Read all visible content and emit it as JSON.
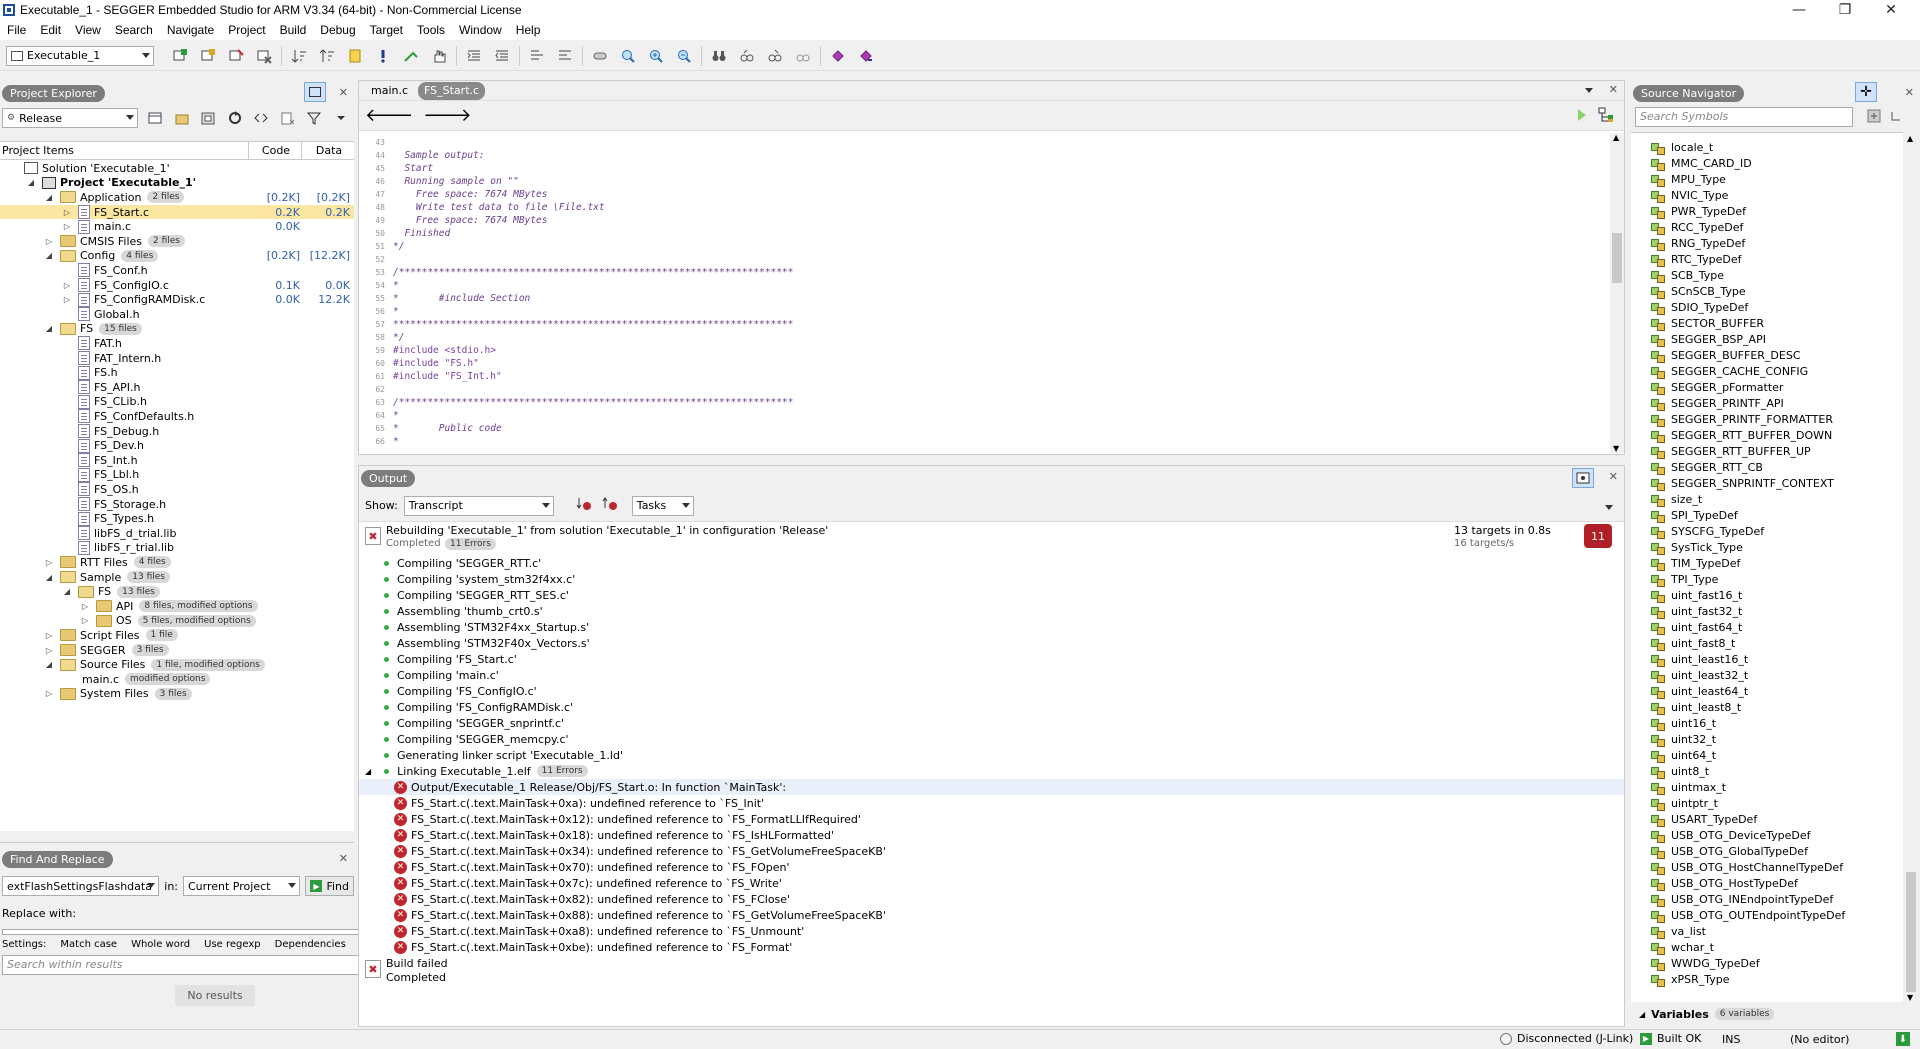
{
  "window": {
    "title": "Executable_1 - SEGGER Embedded Studio for ARM V3.34 (64-bit) - Non-Commercial License",
    "minimize": "—",
    "maximize": "❐",
    "close": "✕"
  },
  "menu": [
    "File",
    "Edit",
    "View",
    "Search",
    "Navigate",
    "Project",
    "Build",
    "Debug",
    "Target",
    "Tools",
    "Window",
    "Help"
  ],
  "toolbar": {
    "project_combo": "Executable_1"
  },
  "project_explorer": {
    "title": "Project Explorer",
    "config": "Release",
    "columns": {
      "items": "Project Items",
      "code": "Code",
      "data": "Data"
    },
    "rows": [
      {
        "label": "Solution 'Executable_1'",
        "kind": "solution",
        "indent": 0,
        "tw": "",
        "badge": "",
        "code": "",
        "data": ""
      },
      {
        "label": "Project 'Executable_1'",
        "kind": "project",
        "indent": 1,
        "tw": "◢",
        "badge": "",
        "code": "",
        "data": "",
        "bold": true
      },
      {
        "label": "Application",
        "kind": "folder-open",
        "indent": 2,
        "tw": "◢",
        "badge": "2 files",
        "code": "[0.2K]",
        "data": "[0.2K]"
      },
      {
        "label": "FS_Start.c",
        "kind": "file",
        "indent": 3,
        "tw": "▷",
        "badge": "",
        "code": "0.2K",
        "data": "0.2K",
        "sel": true
      },
      {
        "label": "main.c",
        "kind": "file",
        "indent": 3,
        "tw": "▷",
        "badge": "",
        "code": "0.0K",
        "data": ""
      },
      {
        "label": "CMSIS Files",
        "kind": "folder",
        "indent": 2,
        "tw": "▷",
        "badge": "2 files",
        "code": "",
        "data": ""
      },
      {
        "label": "Config",
        "kind": "folder-open",
        "indent": 2,
        "tw": "◢",
        "badge": "4 files",
        "code": "[0.2K]",
        "data": "[12.2K]"
      },
      {
        "label": "FS_Conf.h",
        "kind": "file",
        "indent": 3,
        "tw": "",
        "badge": "",
        "code": "",
        "data": ""
      },
      {
        "label": "FS_ConfigIO.c",
        "kind": "file",
        "indent": 3,
        "tw": "▷",
        "badge": "",
        "code": "0.1K",
        "data": "0.0K"
      },
      {
        "label": "FS_ConfigRAMDisk.c",
        "kind": "file",
        "indent": 3,
        "tw": "▷",
        "badge": "",
        "code": "0.0K",
        "data": "12.2K"
      },
      {
        "label": "Global.h",
        "kind": "file",
        "indent": 3,
        "tw": "",
        "badge": "",
        "code": "",
        "data": ""
      },
      {
        "label": "FS",
        "kind": "folder-open",
        "indent": 2,
        "tw": "◢",
        "badge": "15 files",
        "code": "",
        "data": ""
      },
      {
        "label": "FAT.h",
        "kind": "file",
        "indent": 3,
        "tw": "",
        "badge": "",
        "code": "",
        "data": ""
      },
      {
        "label": "FAT_Intern.h",
        "kind": "file",
        "indent": 3,
        "tw": "",
        "badge": "",
        "code": "",
        "data": ""
      },
      {
        "label": "FS.h",
        "kind": "file",
        "indent": 3,
        "tw": "",
        "badge": "",
        "code": "",
        "data": ""
      },
      {
        "label": "FS_API.h",
        "kind": "file",
        "indent": 3,
        "tw": "",
        "badge": "",
        "code": "",
        "data": ""
      },
      {
        "label": "FS_CLib.h",
        "kind": "file",
        "indent": 3,
        "tw": "",
        "badge": "",
        "code": "",
        "data": ""
      },
      {
        "label": "FS_ConfDefaults.h",
        "kind": "file",
        "indent": 3,
        "tw": "",
        "badge": "",
        "code": "",
        "data": ""
      },
      {
        "label": "FS_Debug.h",
        "kind": "file",
        "indent": 3,
        "tw": "",
        "badge": "",
        "code": "",
        "data": ""
      },
      {
        "label": "FS_Dev.h",
        "kind": "file",
        "indent": 3,
        "tw": "",
        "badge": "",
        "code": "",
        "data": ""
      },
      {
        "label": "FS_Int.h",
        "kind": "file",
        "indent": 3,
        "tw": "",
        "badge": "",
        "code": "",
        "data": ""
      },
      {
        "label": "FS_Lbl.h",
        "kind": "file",
        "indent": 3,
        "tw": "",
        "badge": "",
        "code": "",
        "data": ""
      },
      {
        "label": "FS_OS.h",
        "kind": "file",
        "indent": 3,
        "tw": "",
        "badge": "",
        "code": "",
        "data": ""
      },
      {
        "label": "FS_Storage.h",
        "kind": "file",
        "indent": 3,
        "tw": "",
        "badge": "",
        "code": "",
        "data": ""
      },
      {
        "label": "FS_Types.h",
        "kind": "file",
        "indent": 3,
        "tw": "",
        "badge": "",
        "code": "",
        "data": ""
      },
      {
        "label": "libFS_d_trial.lib",
        "kind": "file",
        "indent": 3,
        "tw": "",
        "badge": "",
        "code": "",
        "data": ""
      },
      {
        "label": "libFS_r_trial.lib",
        "kind": "file",
        "indent": 3,
        "tw": "",
        "badge": "",
        "code": "",
        "data": ""
      },
      {
        "label": "RTT Files",
        "kind": "folder",
        "indent": 2,
        "tw": "▷",
        "badge": "4 files",
        "code": "",
        "data": ""
      },
      {
        "label": "Sample",
        "kind": "folder-open",
        "indent": 2,
        "tw": "◢",
        "badge": "13 files",
        "code": "",
        "data": ""
      },
      {
        "label": "FS",
        "kind": "folder-open",
        "indent": 3,
        "tw": "◢",
        "badge": "13 files",
        "code": "",
        "data": ""
      },
      {
        "label": "API",
        "kind": "folder",
        "indent": 4,
        "tw": "▷",
        "badge": "8 files, modified options",
        "code": "",
        "data": ""
      },
      {
        "label": "OS",
        "kind": "folder",
        "indent": 4,
        "tw": "▷",
        "badge": "5 files, modified options",
        "code": "",
        "data": ""
      },
      {
        "label": "Script Files",
        "kind": "folder",
        "indent": 2,
        "tw": "▷",
        "badge": "1 file",
        "code": "",
        "data": ""
      },
      {
        "label": "SEGGER",
        "kind": "folder",
        "indent": 2,
        "tw": "▷",
        "badge": "3 files",
        "code": "",
        "data": ""
      },
      {
        "label": "Source Files",
        "kind": "folder-open",
        "indent": 2,
        "tw": "◢",
        "badge": "1 file, modified options",
        "code": "",
        "data": ""
      },
      {
        "label": "main.c",
        "kind": "plain",
        "indent": 3,
        "tw": "",
        "badge": "modified options",
        "code": "",
        "data": ""
      },
      {
        "label": "System Files",
        "kind": "folder",
        "indent": 2,
        "tw": "▷",
        "badge": "3 files",
        "code": "",
        "data": ""
      }
    ]
  },
  "find_replace": {
    "title": "Find And Replace",
    "find_value": "extFlashSettingsFlashdata",
    "in_label": "in:",
    "scope": "Current Project",
    "find_button": "Find",
    "replace_label": "Replace with:",
    "settings_label": "Settings:",
    "options": [
      "Match case",
      "Whole word",
      "Use regexp",
      "Dependencies"
    ],
    "search_placeholder": "Search within results",
    "no_results": "No results"
  },
  "editor": {
    "tabs": [
      "main.c",
      "FS_Start.c"
    ],
    "lines": [
      {
        "n": "43",
        "t": ""
      },
      {
        "n": "44",
        "t": "  Sample output:"
      },
      {
        "n": "45",
        "t": "  Start"
      },
      {
        "n": "46",
        "t": "  Running sample on \"\""
      },
      {
        "n": "47",
        "t": "    Free space: 7674 MBytes"
      },
      {
        "n": "48",
        "t": "    Write test data to file \\File.txt"
      },
      {
        "n": "49",
        "t": "    Free space: 7674 MBytes"
      },
      {
        "n": "50",
        "t": "  Finished"
      },
      {
        "n": "51",
        "t": "*/"
      },
      {
        "n": "52",
        "t": ""
      },
      {
        "n": "53",
        "t": "/*********************************************************************"
      },
      {
        "n": "54",
        "t": "*"
      },
      {
        "n": "55",
        "t": "*       #include Section"
      },
      {
        "n": "56",
        "t": "*"
      },
      {
        "n": "57",
        "t": "**********************************************************************"
      },
      {
        "n": "58",
        "t": "*/"
      },
      {
        "n": "59",
        "t": "#include <stdio.h>"
      },
      {
        "n": "60",
        "t": "#include \"FS.h\""
      },
      {
        "n": "61",
        "t": "#include \"FS_Int.h\""
      },
      {
        "n": "62",
        "t": ""
      },
      {
        "n": "63",
        "t": "/*********************************************************************"
      },
      {
        "n": "64",
        "t": "*"
      },
      {
        "n": "65",
        "t": "*       Public code"
      },
      {
        "n": "66",
        "t": "*"
      }
    ]
  },
  "output": {
    "title": "Output",
    "show_label": "Show:",
    "show_value": "Transcript",
    "tasks_value": "Tasks",
    "header": {
      "text": "Rebuilding 'Executable_1' from solution 'Executable_1' in configuration 'Release'",
      "status": "Completed",
      "errors_badge": "11 Errors",
      "targets": "13 targets in 0.8s",
      "rate": "16 targets/s",
      "error_count": "11"
    },
    "steps": [
      "Compiling 'SEGGER_RTT.c'",
      "Compiling 'system_stm32f4xx.c'",
      "Compiling 'SEGGER_RTT_SES.c'",
      "Assembling 'thumb_crt0.s'",
      "Assembling 'STM32F4xx_Startup.s'",
      "Assembling 'STM32F40x_Vectors.s'",
      "Compiling 'FS_Start.c'",
      "Compiling 'main.c'",
      "Compiling 'FS_ConfigIO.c'",
      "Compiling 'FS_ConfigRAMDisk.c'",
      "Compiling 'SEGGER_snprintf.c'",
      "Compiling 'SEGGER_memcpy.c'",
      "Generating linker script 'Executable_1.ld'"
    ],
    "link_step": "Linking Executable_1.elf",
    "link_badge": "11 Errors",
    "errors": [
      "Output/Executable_1 Release/Obj/FS_Start.o: In function `MainTask':",
      "FS_Start.c(.text.MainTask+0xa): undefined reference to `FS_Init'",
      "FS_Start.c(.text.MainTask+0x12): undefined reference to `FS_FormatLLIfRequired'",
      "FS_Start.c(.text.MainTask+0x18): undefined reference to `FS_IsHLFormatted'",
      "FS_Start.c(.text.MainTask+0x34): undefined reference to `FS_GetVolumeFreeSpaceKB'",
      "FS_Start.c(.text.MainTask+0x70): undefined reference to `FS_FOpen'",
      "FS_Start.c(.text.MainTask+0x7c): undefined reference to `FS_Write'",
      "FS_Start.c(.text.MainTask+0x82): undefined reference to `FS_FClose'",
      "FS_Start.c(.text.MainTask+0x88): undefined reference to `FS_GetVolumeFreeSpaceKB'",
      "FS_Start.c(.text.MainTask+0xa8): undefined reference to `FS_Unmount'",
      "FS_Start.c(.text.MainTask+0xbe): undefined reference to `FS_Format'"
    ],
    "footer": {
      "text": "Build failed",
      "status": "Completed"
    }
  },
  "navigator": {
    "title": "Source Navigator",
    "search_placeholder": "Search Symbols",
    "symbols": [
      "locale_t",
      "MMC_CARD_ID",
      "MPU_Type",
      "NVIC_Type",
      "PWR_TypeDef",
      "RCC_TypeDef",
      "RNG_TypeDef",
      "RTC_TypeDef",
      "SCB_Type",
      "SCnSCB_Type",
      "SDIO_TypeDef",
      "SECTOR_BUFFER",
      "SEGGER_BSP_API",
      "SEGGER_BUFFER_DESC",
      "SEGGER_CACHE_CONFIG",
      "SEGGER_pFormatter",
      "SEGGER_PRINTF_API",
      "SEGGER_PRINTF_FORMATTER",
      "SEGGER_RTT_BUFFER_DOWN",
      "SEGGER_RTT_BUFFER_UP",
      "SEGGER_RTT_CB",
      "SEGGER_SNPRINTF_CONTEXT",
      "size_t",
      "SPI_TypeDef",
      "SYSCFG_TypeDef",
      "SysTick_Type",
      "TIM_TypeDef",
      "TPI_Type",
      "uint_fast16_t",
      "uint_fast32_t",
      "uint_fast64_t",
      "uint_fast8_t",
      "uint_least16_t",
      "uint_least32_t",
      "uint_least64_t",
      "uint_least8_t",
      "uint16_t",
      "uint32_t",
      "uint64_t",
      "uint8_t",
      "uintmax_t",
      "uintptr_t",
      "USART_TypeDef",
      "USB_OTG_DeviceTypeDef",
      "USB_OTG_GlobalTypeDef",
      "USB_OTG_HostChannelTypeDef",
      "USB_OTG_HostTypeDef",
      "USB_OTG_INEndpointTypeDef",
      "USB_OTG_OUTEndpointTypeDef",
      "va_list",
      "wchar_t",
      "WWDG_TypeDef",
      "xPSR_Type"
    ],
    "variables_label": "Variables",
    "variables_badge": "6 variables"
  },
  "status": {
    "connection": "Disconnected (J-Link)",
    "build": "Built OK",
    "mode": "INS",
    "editor": "(No editor)"
  },
  "colors": {
    "error": "#c0262d",
    "ok": "#36a845",
    "selection": "#fbe6a2"
  }
}
